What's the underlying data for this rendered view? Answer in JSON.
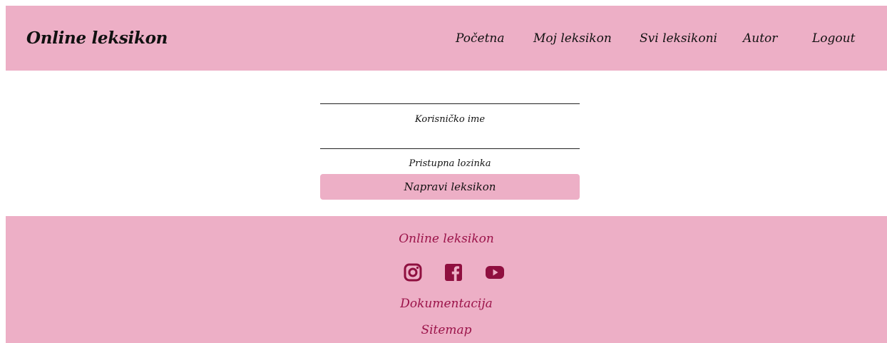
{
  "header": {
    "brand": "Online leksikon",
    "nav": [
      {
        "label": "Početna"
      },
      {
        "label": "Moj leksikon"
      },
      {
        "label": "Svi leksikoni"
      },
      {
        "label": "Autor"
      },
      {
        "label": "Logout"
      }
    ]
  },
  "form": {
    "username_label": "Korisničko ime",
    "username_value": "",
    "password_label": "Pristupna lozinka",
    "password_value": "",
    "submit_label": "Napravi leksikon"
  },
  "footer": {
    "title": "Online leksikon",
    "social": [
      {
        "icon": "instagram-icon"
      },
      {
        "icon": "facebook-icon"
      },
      {
        "icon": "youtube-icon"
      }
    ],
    "documentation_label": "Dokumentacija",
    "sitemap_label": "Sitemap"
  },
  "colors": {
    "header_bg": "#edafc6",
    "footer_bg": "#edafc6",
    "footer_text": "#9b1349",
    "icon": "#8f0f3f",
    "text": "#111111"
  }
}
